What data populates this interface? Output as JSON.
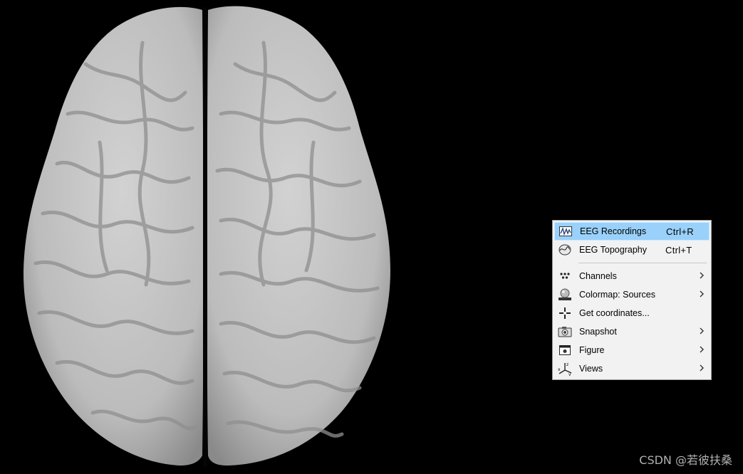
{
  "viewport": {
    "background": "#000000",
    "brain_color": "#c9c9c9"
  },
  "context_menu": {
    "items": [
      {
        "label": "EEG Recordings",
        "shortcut": "Ctrl+R",
        "icon": "eeg-recordings-icon",
        "highlighted": true
      },
      {
        "label": "EEG Topography",
        "shortcut": "Ctrl+T",
        "icon": "eeg-topography-icon"
      },
      {
        "label": "Channels",
        "icon": "channels-icon",
        "submenu": true
      },
      {
        "label": "Colormap: Sources",
        "icon": "colormap-icon",
        "submenu": true
      },
      {
        "label": "Get coordinates...",
        "icon": "crosshair-icon"
      },
      {
        "label": "Snapshot",
        "icon": "camera-icon",
        "submenu": true
      },
      {
        "label": "Figure",
        "icon": "figure-icon",
        "submenu": true
      },
      {
        "label": "Views",
        "icon": "axes-icon",
        "submenu": true
      }
    ],
    "highlight_color": "#99d1fb"
  },
  "watermark": "CSDN @若彼扶桑"
}
